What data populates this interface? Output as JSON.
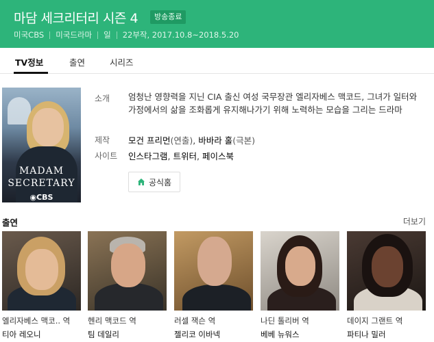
{
  "header": {
    "title": "마담 세크리터리 시즌 4",
    "badge": "방송종료",
    "meta": {
      "channel": "미국CBS",
      "genre": "미국드라마",
      "day": "일",
      "episodes_period": "22부작, 2017.10.8~2018.5.20"
    }
  },
  "tabs": [
    {
      "label": "TV정보",
      "active": true
    },
    {
      "label": "출연",
      "active": false
    },
    {
      "label": "시리즈",
      "active": false
    }
  ],
  "poster": {
    "title_line1": "MADAM",
    "title_line2": "SECRETARY",
    "network": "◉CBS"
  },
  "info": {
    "synopsis_label": "소개",
    "synopsis": "엄청난 영향력을 지닌 CIA 출신 여성 국무장관 엘리자베스 맥코드, 그녀가 일터와 가정에서의 삶을 조화롭게 유지해나가기 위해 노력하는 모습을 그리는 드라마",
    "production_label": "제작",
    "director_name": "모건 프리먼",
    "director_role": "(연출)",
    "separator": ", ",
    "writer_name": "바바라 홀",
    "writer_role": "(극본)",
    "site_label": "사이트",
    "sites": [
      "인스타그램",
      "트위터",
      "페이스북"
    ],
    "site_sep": ", ",
    "homepage_button": "공식홈"
  },
  "cast": {
    "heading": "출연",
    "more_label": "더보기",
    "members": [
      {
        "role": "엘리자베스 맥코.. 역",
        "name": "티아 레오니"
      },
      {
        "role": "헨리 맥코드 역",
        "name": "팀 데일리"
      },
      {
        "role": "러셀 잭슨 역",
        "name": "젤리코 이바넥"
      },
      {
        "role": "나딘 톨리버 역",
        "name": "베베 뉴워스"
      },
      {
        "role": "데이지 그랜트 역",
        "name": "파티나 밀러"
      }
    ]
  },
  "colors": {
    "header_bg": "#2db47a",
    "badge_bg": "#1f9a63",
    "accent_icon": "#2db47a"
  }
}
